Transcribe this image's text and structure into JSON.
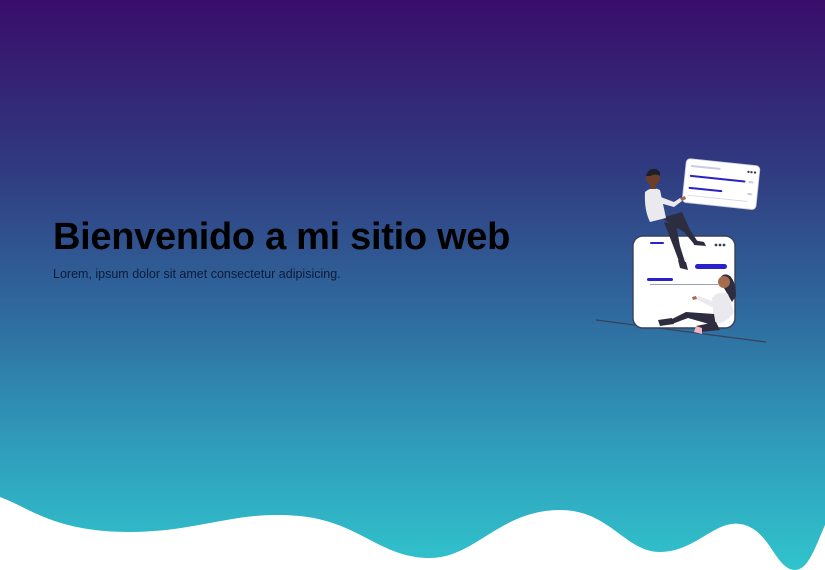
{
  "hero": {
    "title": "Bienvenido a mi sitio web",
    "subtitle": "Lorem, ipsum dolor sit amet consectetur adipisicing."
  },
  "illustration": {
    "icon": "people-with-web-cards-illustration"
  },
  "colors": {
    "gradient_top": "#390d6b",
    "gradient_bottom": "#30c4cc",
    "title_text": "#000000",
    "wave_fill": "#ffffff",
    "accent_bar": "#2a22c9"
  }
}
